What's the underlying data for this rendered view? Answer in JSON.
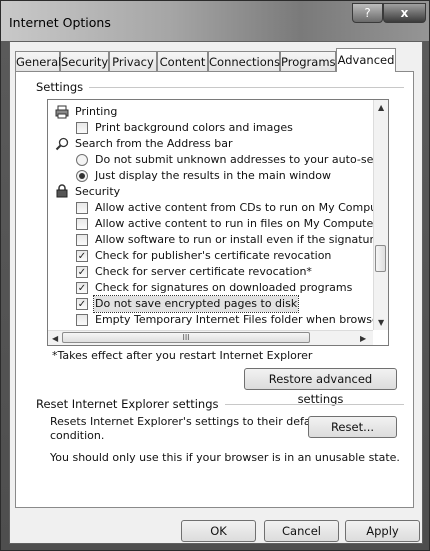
{
  "window": {
    "title": "Internet Options",
    "help_glyph": "?",
    "close_glyph": "x"
  },
  "tabs": [
    "General",
    "Security",
    "Privacy",
    "Content",
    "Connections",
    "Programs",
    "Advanced"
  ],
  "active_tab": "Advanced",
  "settings": {
    "group_label": "Settings",
    "items": [
      {
        "type": "category",
        "icon": "printer-icon",
        "label": "Printing"
      },
      {
        "type": "checkbox",
        "checked": false,
        "label": "Print background colors and images"
      },
      {
        "type": "category",
        "icon": "magnifier-icon",
        "label": "Search from the Address bar"
      },
      {
        "type": "radio",
        "checked": false,
        "label": "Do not submit unknown addresses to your auto-search pro"
      },
      {
        "type": "radio",
        "checked": true,
        "label": "Just display the results in the main window"
      },
      {
        "type": "category",
        "icon": "lock-icon",
        "label": "Security"
      },
      {
        "type": "checkbox",
        "checked": false,
        "label": "Allow active content from CDs to run on My Computer*"
      },
      {
        "type": "checkbox",
        "checked": false,
        "label": "Allow active content to run in files on My Computer*"
      },
      {
        "type": "checkbox",
        "checked": false,
        "label": "Allow software to run or install even if the signature is inva"
      },
      {
        "type": "checkbox",
        "checked": true,
        "label": "Check for publisher's certificate revocation"
      },
      {
        "type": "checkbox",
        "checked": true,
        "label": "Check for server certificate revocation*"
      },
      {
        "type": "checkbox",
        "checked": true,
        "label": "Check for signatures on downloaded programs"
      },
      {
        "type": "checkbox",
        "checked": true,
        "label": "Do not save encrypted pages to disk",
        "selected": true
      },
      {
        "type": "checkbox",
        "checked": false,
        "label": "Empty Temporary Internet Files folder when browser is clo"
      }
    ],
    "check_glyph": "✓",
    "scroll_thumb_grip": "III",
    "footnote": "*Takes effect after you restart Internet Explorer",
    "restore_button": "Restore advanced settings"
  },
  "reset_section": {
    "group_label": "Reset Internet Explorer settings",
    "description_line1": "Resets Internet Explorer's settings to their default",
    "description_line2": "condition.",
    "reset_button": "Reset...",
    "warning": "You should only use this if your browser is in an unusable state."
  },
  "footer_buttons": {
    "ok": "OK",
    "cancel": "Cancel",
    "apply": "Apply"
  }
}
